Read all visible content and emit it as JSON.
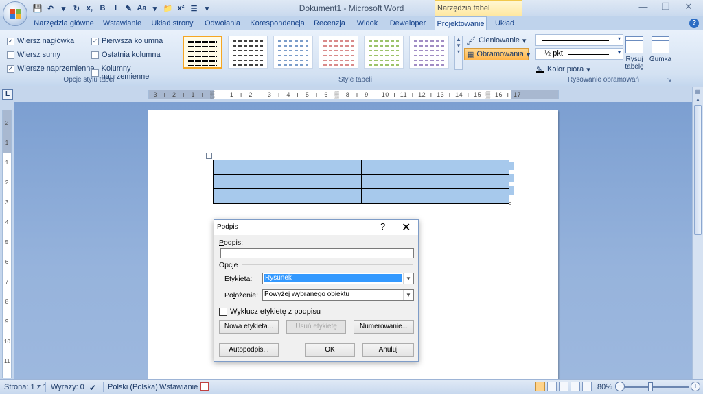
{
  "window": {
    "title": "Dokument1 - Microsoft Word",
    "contextual_tab_title": "Narzędzia tabel",
    "controls": [
      "—",
      "❐",
      "✕"
    ]
  },
  "quick_access": [
    "💾",
    "↶",
    "▾",
    "↻",
    "x,",
    "B",
    "I",
    "✎",
    "Aa",
    "▾",
    "📁",
    "x²",
    "☰",
    "▾"
  ],
  "tabs": [
    {
      "label": "Narzędzia główne"
    },
    {
      "label": "Wstawianie"
    },
    {
      "label": "Układ strony"
    },
    {
      "label": "Odwołania"
    },
    {
      "label": "Korespondencja"
    },
    {
      "label": "Recenzja"
    },
    {
      "label": "Widok"
    },
    {
      "label": "Deweloper"
    },
    {
      "label": "Projektowanie"
    },
    {
      "label": "Układ"
    }
  ],
  "active_tab": "Projektowanie",
  "ribbon": {
    "table_style_options": {
      "label": "Opcje stylu tabeli",
      "items": [
        {
          "label": "Wiersz nagłówka",
          "checked": true
        },
        {
          "label": "Wiersz sumy",
          "checked": false
        },
        {
          "label": "Wiersze naprzemienne",
          "checked": true
        },
        {
          "label": "Pierwsza kolumna",
          "checked": true
        },
        {
          "label": "Ostatnia kolumna",
          "checked": false
        },
        {
          "label": "Kolumny naprzemienne",
          "checked": false
        }
      ]
    },
    "table_styles": {
      "label": "Style tabeli",
      "thumb_colors": [
        "#000000",
        "#404040",
        "#7a9cc9",
        "#d98a8a",
        "#9cc36a",
        "#a08cc4"
      ],
      "shading": "Cieniowanie",
      "borders": "Obramowania"
    },
    "draw_borders": {
      "label": "Rysowanie obramowań",
      "weight": "½ pkt",
      "pen_color": "Kolor pióra",
      "draw_table": "Rysuj tabelę",
      "eraser": "Gumka"
    }
  },
  "ruler": {
    "horizontal": "· 3 · ı · 2 · ı · 1 · ı · ▒ · ı · 1 · ı · 2 · ı · 3 · ı · 4 · ı · 5 · ı · 6 · ▒ · 8 · ı · 9 · ı ·10· ı ·11· ı ·12· ı ·13· ı ·14· ı ·15· ▒ ·16· ı ·17·",
    "vertical": [
      "2",
      "1",
      "1",
      "2",
      "3",
      "4",
      "5",
      "6",
      "7",
      "8",
      "9",
      "10",
      "11"
    ]
  },
  "dialog": {
    "title": "Podpis",
    "help": "?",
    "close": "✕",
    "caption_label": "Podpis:",
    "caption_value": "",
    "options_label": "Opcje",
    "label_label": "Etykieta:",
    "label_value": "Rysunek",
    "position_label": "Położenie:",
    "position_value": "Powyżej wybranego obiektu",
    "exclude_label": "Wyklucz etykietę z podpisu",
    "exclude_checked": false,
    "new_label_btn": "Nowa etykieta...",
    "delete_label_btn": "Usuń etykietę",
    "numbering_btn": "Numerowanie...",
    "autocaption_btn": "Autopodpis...",
    "ok_btn": "OK",
    "cancel_btn": "Anuluj"
  },
  "status": {
    "page": "Strona: 1 z 1",
    "words": "Wyrazy: 0",
    "language": "Polski (Polska)",
    "mode": "Wstawianie",
    "zoom": "80%"
  }
}
